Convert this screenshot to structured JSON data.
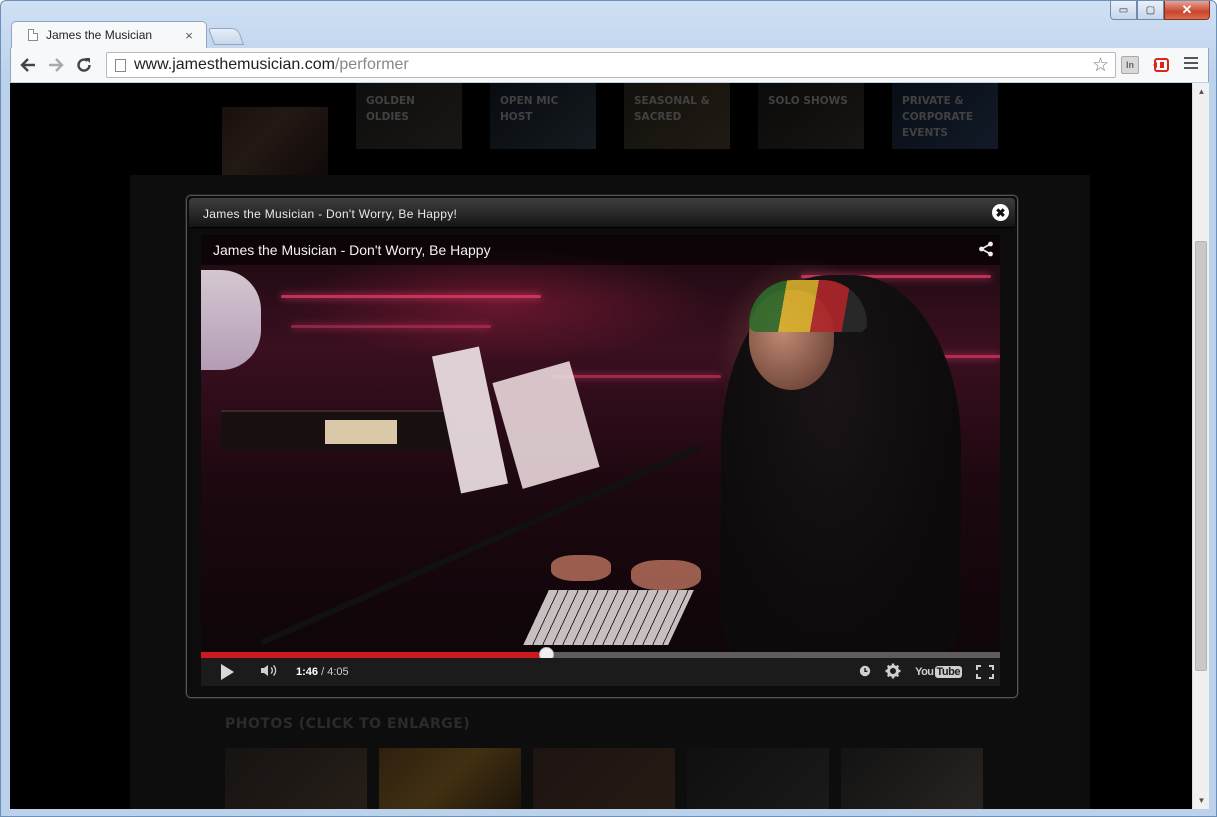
{
  "browser": {
    "tab_title": "James the Musician",
    "tab_close": "×",
    "url_host": "www.jamesthemusician.com",
    "url_path": "/performer",
    "ext_in_label": "In",
    "window_controls": {
      "minimize": "▭",
      "maximize": "▢",
      "close": "✕"
    }
  },
  "page": {
    "categories": [
      {
        "label": "Golden Oldies"
      },
      {
        "label": "Open Mic Host"
      },
      {
        "label": "Seasonal & Sacred"
      },
      {
        "label": "Solo Shows"
      },
      {
        "label": "Private & Corporate Events"
      }
    ],
    "photos_heading": "Photos (click to enlarge)"
  },
  "lightbox": {
    "title": "James the Musician - Don't Worry, Be Happy!",
    "close_label": "✖"
  },
  "video": {
    "title": "James the Musician - Don't Worry, Be Happy",
    "current_time": "1:46",
    "separator": " / ",
    "duration": "4:05",
    "progress_fraction": 0.433,
    "youtube_label": "You",
    "youtube_label_tube": "Tube",
    "progress_color": "#cc181e"
  },
  "icons": {
    "back": "arrow-left-icon",
    "forward": "arrow-right-icon",
    "reload": "reload-icon",
    "star": "star-icon",
    "menu": "menu-icon",
    "share": "share-icon",
    "play": "play-icon",
    "volume": "volume-icon",
    "watch_later": "clock-icon",
    "settings": "gear-icon",
    "fullscreen": "fullscreen-icon"
  }
}
